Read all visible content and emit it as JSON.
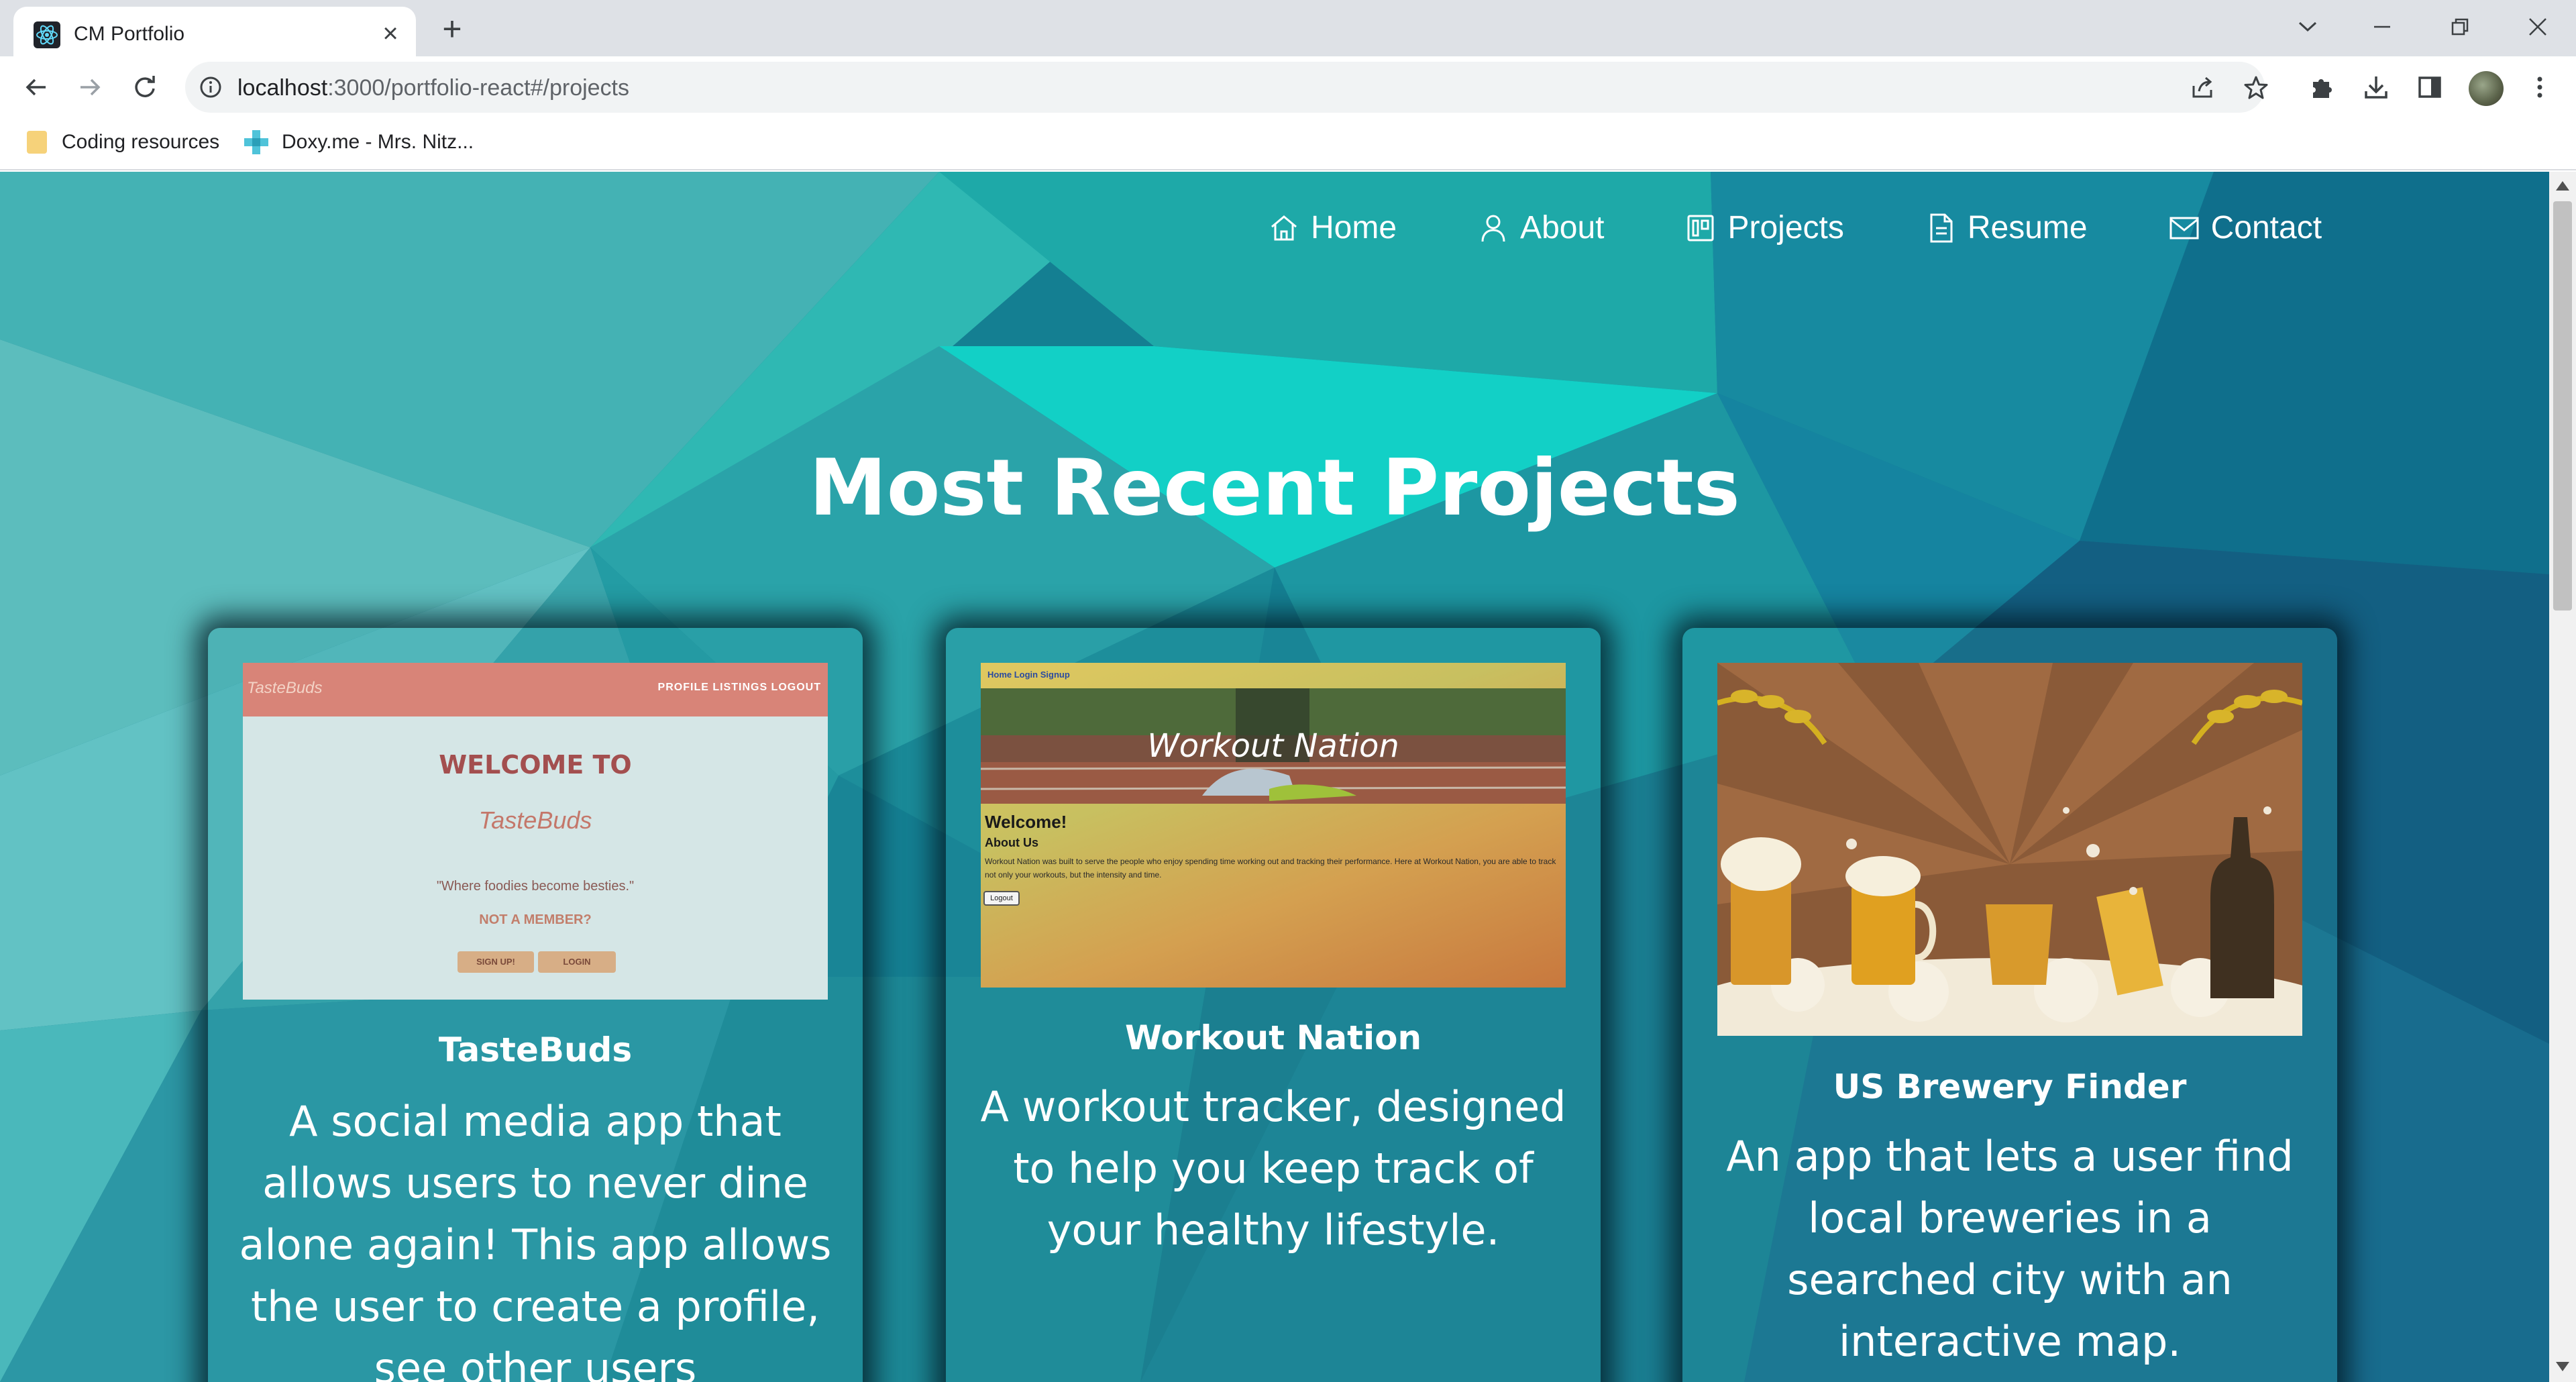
{
  "browser": {
    "tab_title": "CM Portfolio",
    "url_host": "localhost",
    "url_path": ":3000/portfolio-react#/projects",
    "bookmarks": [
      {
        "label": "Coding resources",
        "icon": "folder-icon"
      },
      {
        "label": "Doxy.me - Mrs. Nitz...",
        "icon": "doxy-icon"
      }
    ]
  },
  "site_nav": {
    "items": [
      {
        "label": "Home",
        "icon": "home-icon"
      },
      {
        "label": "About",
        "icon": "user-icon"
      },
      {
        "label": "Projects",
        "icon": "projects-icon"
      },
      {
        "label": "Resume",
        "icon": "document-icon"
      },
      {
        "label": "Contact",
        "icon": "mail-icon"
      }
    ]
  },
  "page": {
    "title": "Most Recent Projects"
  },
  "projects": [
    {
      "title": "TasteBuds",
      "description": "A social media app that allows users to never dine alone again! This app allows the user to create a profile, see other users",
      "screenshot": {
        "logo_small": "TasteBuds",
        "links": "PROFILE  LISTINGS  LOGOUT",
        "welcome": "WELCOME TO",
        "logo": "TasteBuds",
        "tagline": "\"Where foodies become besties.\"",
        "not_member": "NOT A MEMBER?",
        "signup": "SIGN UP!",
        "login": "LOGIN"
      }
    },
    {
      "title": "Workout Nation",
      "description": "A workout tracker, designed to help you keep track of your healthy lifestyle.",
      "screenshot": {
        "nav": "Home  Login  Signup",
        "hero_title": "Workout Nation",
        "welcome": "Welcome!",
        "about": "About Us",
        "text": "Workout Nation was built to serve the people who enjoy spending time working out and tracking their performance. Here at Workout Nation, you are able to track not only your workouts, but the intensity and time.",
        "logout": "Logout"
      }
    },
    {
      "title": "US Brewery Finder",
      "description": "An app that lets a user find local breweries in a searched city with an interactive map."
    }
  ],
  "colors": {
    "accent": "#1fb5b0",
    "card_title": "#ffffff"
  }
}
